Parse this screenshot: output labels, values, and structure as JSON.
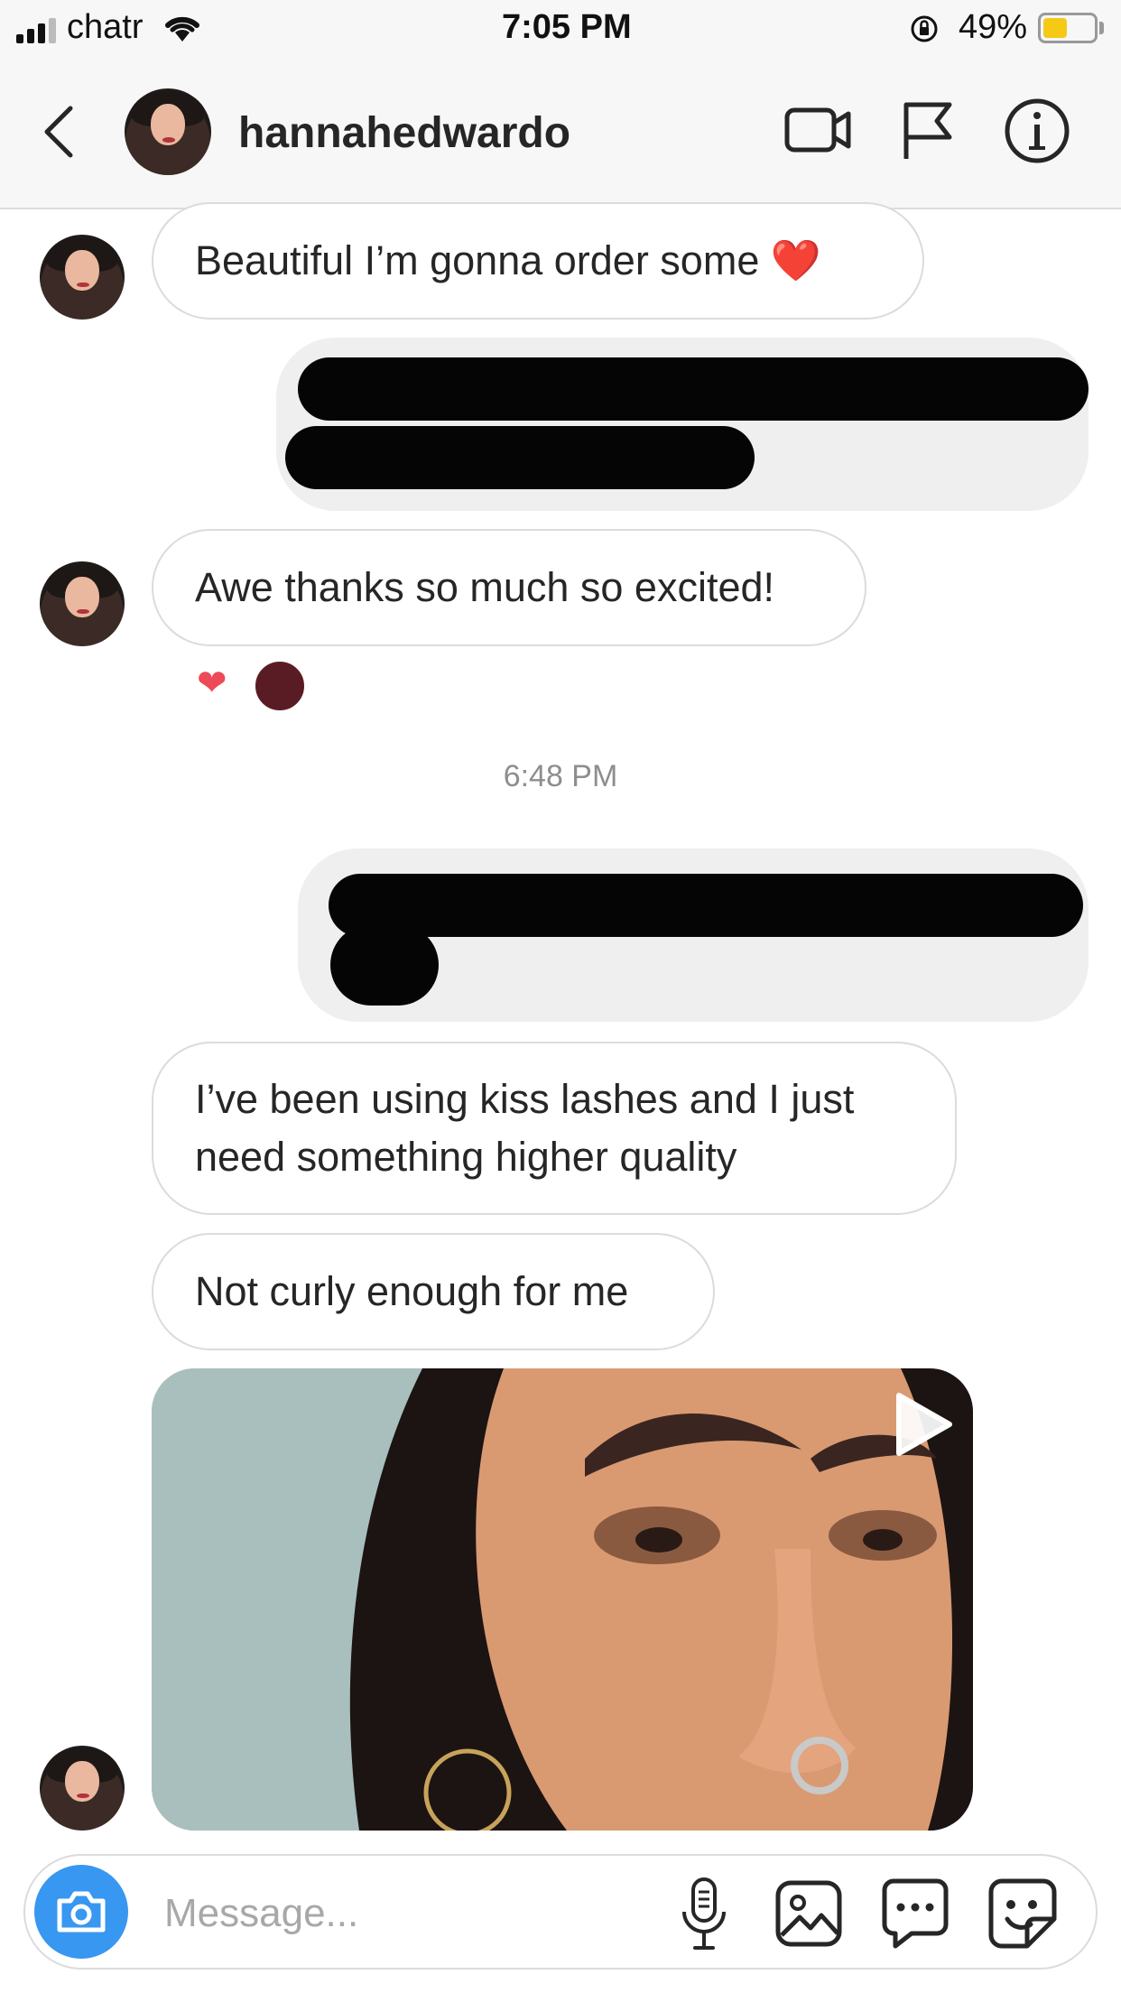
{
  "status_bar": {
    "carrier": "chatr",
    "time": "7:05 PM",
    "battery": "49%",
    "battery_level": 0.49,
    "signal_icon": "cell-signal-icon",
    "wifi_icon": "wifi-icon"
  },
  "header": {
    "username": "hannahedwardo",
    "icons": [
      "back-chevron-icon",
      "video-call-icon",
      "flag-icon",
      "info-icon"
    ]
  },
  "messages": [
    {
      "from": "them",
      "text": "Beautiful I’m gonna order some ❤️"
    },
    {
      "from": "me",
      "redacted": true
    },
    {
      "from": "them",
      "text": "Awe thanks so much so excited!",
      "reactions": [
        "❤"
      ]
    },
    {
      "from": "me",
      "redacted": true
    },
    {
      "from": "them",
      "text": "I’ve been using kiss lashes and I just need something higher quality"
    },
    {
      "from": "them",
      "text": "Not curly enough for me"
    },
    {
      "from": "them",
      "type": "video"
    }
  ],
  "timestamp": "6:48 PM",
  "composer": {
    "placeholder": "Message...",
    "icons": [
      "camera-icon",
      "microphone-icon",
      "gallery-icon",
      "chat-bubble-icon",
      "sticker-icon"
    ]
  },
  "colors": {
    "accent_blue": "#3897f0",
    "heart_red": "#ed4956",
    "battery_yellow": "#f6c917"
  }
}
